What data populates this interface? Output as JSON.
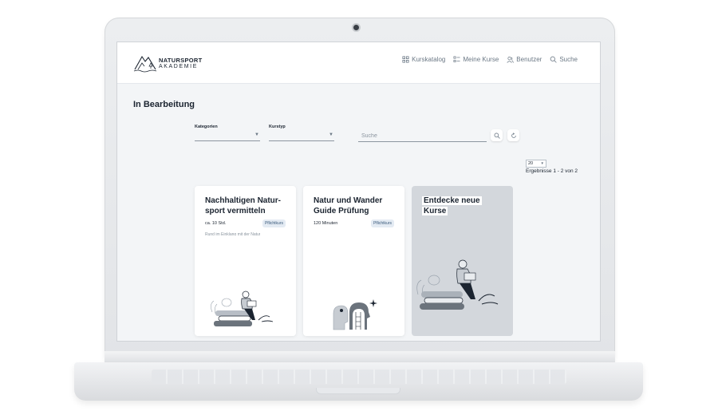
{
  "header": {
    "logo_line1": "NATURSPORT",
    "logo_line2": "AKADEMIE",
    "nav": [
      {
        "label": "Kurskatalog",
        "icon": "grid-icon"
      },
      {
        "label": "Meine Kurse",
        "icon": "list-icon"
      },
      {
        "label": "Benutzer",
        "icon": "users-icon"
      },
      {
        "label": "Suche",
        "icon": "search-icon"
      }
    ]
  },
  "page": {
    "title": "In Bearbeitung"
  },
  "filters": {
    "category_label": "Kategorien",
    "type_label": "Kurstyp",
    "search_placeholder": "Suche"
  },
  "pagination": {
    "per_page": "20",
    "results": "Ergebnisse 1 - 2 von 2"
  },
  "cards": [
    {
      "title": "Nachhaltigen Natur-sport vermitteln",
      "duration": "ca. 10 Std.",
      "badge": "Pflichtkurs",
      "desc": "Rund im Einklang mit der Natur"
    },
    {
      "title": "Natur und Wander Guide Prüfung",
      "duration": "120 Minuten",
      "badge": "Pflichtkurs"
    }
  ],
  "cta": {
    "title_line1": "Entdecke neue",
    "title_line2": "Kurse"
  },
  "colors": {
    "accent": "#3b5b7c",
    "badge_bg": "#e4ebf3",
    "cta_bg": "#d3d7dc"
  }
}
